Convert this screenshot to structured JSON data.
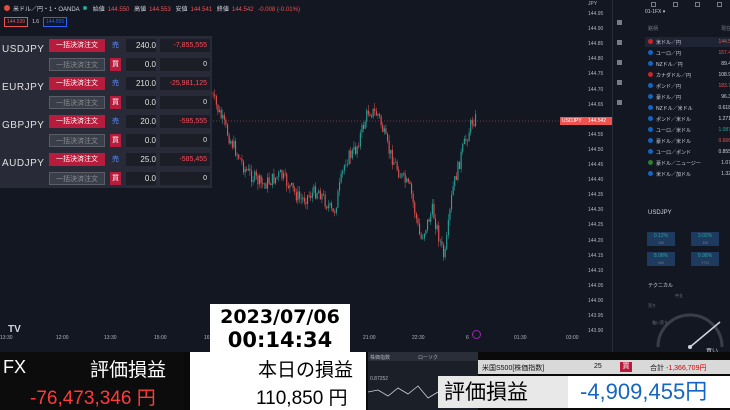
{
  "chart": {
    "symbol": "米ドル／円・1・OANDA",
    "ohlc": [
      {
        "k": "始値",
        "v": "144.550"
      },
      {
        "k": "高値",
        "v": "144.553"
      },
      {
        "k": "安値",
        "v": "144.541"
      },
      {
        "k": "終値",
        "v": "144.542"
      },
      {
        "k": "change",
        "v": "-0.008 (-0.01%)"
      }
    ],
    "sell_price": "144.539",
    "spread": "1.6",
    "buy_price": "144.555",
    "last_price": "144.542",
    "symbol_tag": "USDJPY",
    "price_ticks": [
      "144.95",
      "144.90",
      "144.85",
      "144.80",
      "144.75",
      "144.70",
      "144.65",
      "144.60",
      "144.55",
      "144.50",
      "144.45",
      "144.40",
      "144.35",
      "144.30",
      "144.25",
      "144.20",
      "144.15",
      "144.10",
      "144.05",
      "144.00",
      "143.95",
      "143.90"
    ],
    "time_ticks": [
      "13:30",
      "12:00",
      "13:30",
      "15:00",
      "16:30",
      "18:00",
      "19:30",
      "21:00",
      "22:30",
      "6",
      "01:30",
      "03:00"
    ],
    "currency": "JPY",
    "logo": "TV"
  },
  "positions": [
    {
      "symbol": "USDJPY",
      "rows": [
        {
          "btn": "一括決済注文",
          "btn_state": "active",
          "side": "売",
          "side_type": "buy",
          "qty": "240.0",
          "pl": "-7,855,555",
          "pl_type": "neg"
        },
        {
          "btn": "一括決済注文",
          "btn_state": "inactive",
          "side": "買",
          "side_type": "sell",
          "qty": "0.0",
          "pl": "0",
          "pl_type": "zero"
        }
      ]
    },
    {
      "symbol": "EURJPY",
      "rows": [
        {
          "btn": "一括決済注文",
          "btn_state": "active",
          "side": "売",
          "side_type": "buy",
          "qty": "210.0",
          "pl": "-25,981,125",
          "pl_type": "neg"
        },
        {
          "btn": "一括決済注文",
          "btn_state": "inactive",
          "side": "買",
          "side_type": "sell",
          "qty": "0.0",
          "pl": "0",
          "pl_type": "zero"
        }
      ]
    },
    {
      "symbol": "GBPJPY",
      "rows": [
        {
          "btn": "一括決済注文",
          "btn_state": "active",
          "side": "売",
          "side_type": "buy",
          "qty": "20.0",
          "pl": "-595,555",
          "pl_type": "neg"
        },
        {
          "btn": "一括決済注文",
          "btn_state": "inactive",
          "side": "買",
          "side_type": "sell",
          "qty": "0.0",
          "pl": "0",
          "pl_type": "zero"
        }
      ]
    },
    {
      "symbol": "AUDJPY",
      "rows": [
        {
          "btn": "一括決済注文",
          "btn_state": "active",
          "side": "売",
          "side_type": "buy",
          "qty": "25.0",
          "pl": "-585,455",
          "pl_type": "neg"
        },
        {
          "btn": "一括決済注文",
          "btn_state": "inactive",
          "side": "買",
          "side_type": "sell",
          "qty": "0.0",
          "pl": "0",
          "pl_type": "zero"
        }
      ]
    }
  ],
  "datetime": {
    "date": "2023/07/06",
    "time": "00:14:34"
  },
  "watchlist": {
    "title": "01-1FX ▾",
    "head": {
      "sym": "銘柄",
      "price": "現在"
    },
    "items": [
      {
        "name": "米ドル／円",
        "price": "144.5",
        "flag": "red",
        "dir": "dn"
      },
      {
        "name": "ユーロ／円",
        "price": "157.4",
        "flag": "blue",
        "dir": "dn"
      },
      {
        "name": "NZドル／円",
        "price": "89.4",
        "flag": "blue",
        "dir": ""
      },
      {
        "name": "カナダドル／円",
        "price": "108.9",
        "flag": "red",
        "dir": ""
      },
      {
        "name": "ポンド／円",
        "price": "183.7",
        "flag": "blue",
        "dir": "dn"
      },
      {
        "name": "豪ドル／円",
        "price": "96.3",
        "flag": "blue",
        "dir": ""
      },
      {
        "name": "NZドル／米ドル",
        "price": "0.618",
        "flag": "blue",
        "dir": ""
      },
      {
        "name": "ポンド／米ドル",
        "price": "1.271",
        "flag": "blue",
        "dir": ""
      },
      {
        "name": "ユーロ／米ドル",
        "price": "1.087",
        "flag": "blue",
        "dir": "up"
      },
      {
        "name": "豪ドル／米ドル",
        "price": "0.666",
        "flag": "blue",
        "dir": "dn"
      },
      {
        "name": "ユーロ／ポンド",
        "price": "0.855",
        "flag": "blue",
        "dir": ""
      },
      {
        "name": "豪ドル／ニュージー",
        "price": "1.07",
        "flag": "green",
        "dir": ""
      },
      {
        "name": "米ドル／加ドル",
        "price": "1.32",
        "flag": "blue",
        "dir": ""
      }
    ],
    "detail": {
      "symbol": "USDJPY",
      "perf": [
        {
          "v": "0.12%",
          "l": "1W"
        },
        {
          "v": "3.02%",
          "l": "1M"
        },
        {
          "v": "8.08%",
          "l": "6M"
        },
        {
          "v": "9.98%",
          "l": "YTD"
        }
      ],
      "technicals": "テクニカル",
      "gauge": {
        "left": "強い売り",
        "mid": "中立",
        "sell": "売り",
        "right": "買い"
      }
    }
  },
  "bottom": {
    "fx_label": "FX",
    "fx_eval_label": "評価損益",
    "fx_eval_value": "-76,473,346 円",
    "today_label": "本日の損益",
    "today_value": "110,850 円",
    "mini": {
      "a": "株価指数",
      "b": "ローソク",
      "c": "0.87252"
    },
    "sp500": {
      "name": "米国S500[株価指数]",
      "qty": "25",
      "badge": "買",
      "total_label": "合計",
      "total_value": "-1,366,709円"
    },
    "eval_label": "評価損益",
    "eval_value": "-4,909,455円"
  }
}
